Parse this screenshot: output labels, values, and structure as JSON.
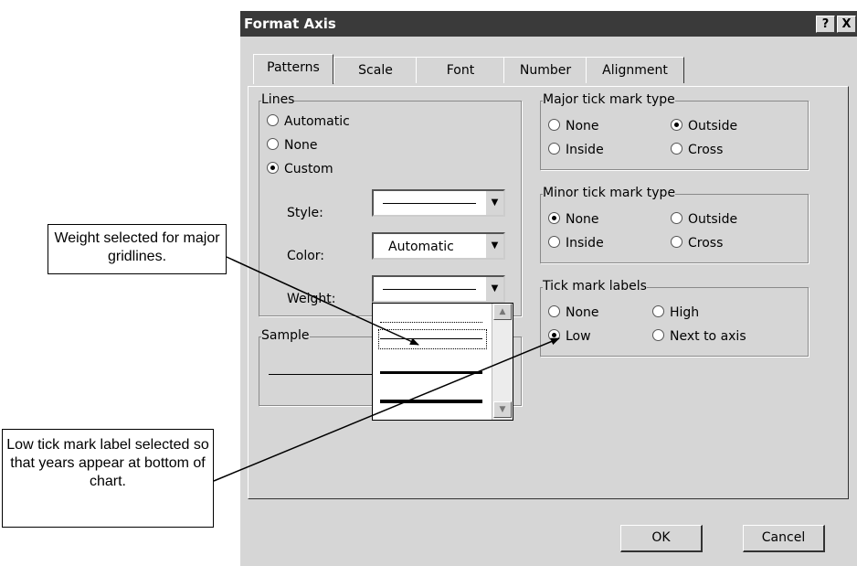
{
  "dialog": {
    "title": "Format Axis",
    "help_btn": "?",
    "close_btn": "X",
    "tabs": [
      "Patterns",
      "Scale",
      "Font",
      "Number",
      "Alignment"
    ],
    "lines": {
      "label": "Lines",
      "automatic": "Automatic",
      "none": "None",
      "custom": "Custom",
      "selected": "Custom",
      "style_label": "Style:",
      "color_label": "Color:",
      "color_value": "Automatic",
      "weight_label": "Weight:"
    },
    "sample_label": "Sample",
    "major": {
      "label": "Major tick mark type",
      "none": "None",
      "outside": "Outside",
      "inside": "Inside",
      "cross": "Cross",
      "selected": "Outside"
    },
    "minor": {
      "label": "Minor tick mark type",
      "none": "None",
      "outside": "Outside",
      "inside": "Inside",
      "cross": "Cross",
      "selected": "None"
    },
    "labels": {
      "label": "Tick mark labels",
      "none": "None",
      "high": "High",
      "low": "Low",
      "next": "Next to axis",
      "selected": "Low"
    },
    "ok": "OK",
    "cancel": "Cancel"
  },
  "callouts": {
    "weight": "Weight selected for major gridlines.",
    "low": "Low tick mark label selected so that years appear at bottom of chart."
  }
}
